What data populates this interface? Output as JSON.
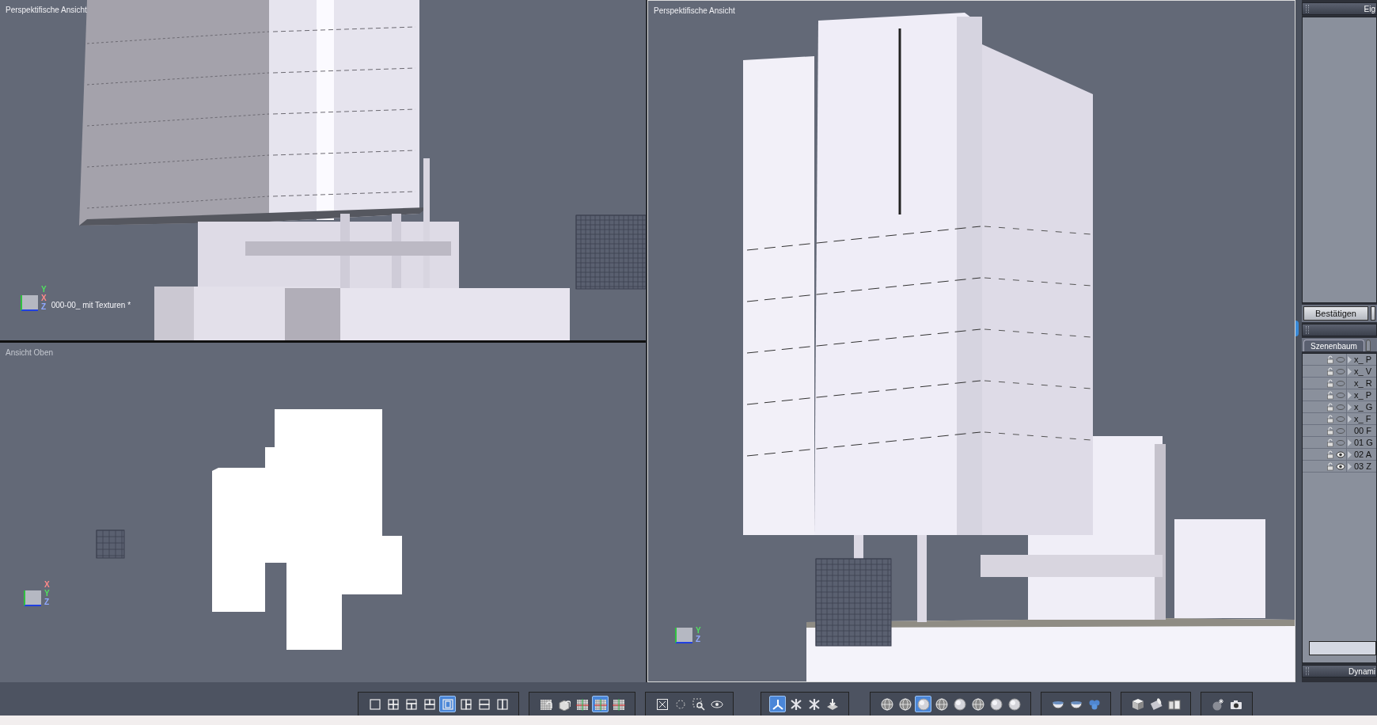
{
  "viewports": [
    {
      "kind": "perspective-left",
      "title": "Perspektifische Ansicht",
      "caption": "000-00_ mit Texturen *",
      "axes": [
        "Y",
        "X",
        "Z"
      ]
    },
    {
      "kind": "top",
      "title": "Ansicht Oben",
      "axes": [
        "X",
        "Y",
        "Z"
      ]
    },
    {
      "kind": "perspective-right",
      "title": "Perspektifische Ansicht",
      "axes": [
        "Y",
        "Z"
      ]
    }
  ],
  "panel": {
    "header": "Eig",
    "confirm_button": "Bestätigen",
    "tabs": [
      {
        "label": "Szenenbaum",
        "selected": true
      }
    ],
    "scene_tree": {
      "items": [
        {
          "label": "x_ P",
          "visible": false,
          "expandable": true
        },
        {
          "label": "x_ V",
          "visible": false,
          "expandable": true
        },
        {
          "label": "x_ R",
          "visible": false,
          "expandable": false
        },
        {
          "label": "x_ P",
          "visible": false,
          "expandable": true
        },
        {
          "label": "x_ G",
          "visible": false,
          "expandable": true
        },
        {
          "label": "x_ F",
          "visible": false,
          "expandable": true
        },
        {
          "label": "00 F",
          "visible": false,
          "expandable": false
        },
        {
          "label": "01 G",
          "visible": false,
          "expandable": true
        },
        {
          "label": "02 A",
          "visible": true,
          "expandable": true
        },
        {
          "label": "03 Z",
          "visible": true,
          "expandable": true
        }
      ]
    },
    "footer_header": "Dynami"
  },
  "toolbar": {
    "groups": [
      {
        "buttons": [
          {
            "kind": "l1",
            "selected": false
          },
          {
            "kind": "l4",
            "selected": false
          },
          {
            "kind": "l3a",
            "selected": false
          },
          {
            "kind": "l3b",
            "selected": false
          },
          {
            "kind": "l2s",
            "selected": true
          },
          {
            "kind": "l3c",
            "selected": false
          },
          {
            "kind": "l2h",
            "selected": false
          },
          {
            "kind": "l2v",
            "selected": false
          }
        ]
      },
      {
        "buttons": [
          {
            "kind": "gridsnap",
            "selected": false
          },
          {
            "kind": "objsnap",
            "selected": false
          },
          {
            "kind": "grid",
            "selected": false
          },
          {
            "kind": "grid",
            "selected": true
          },
          {
            "kind": "grid",
            "selected": false
          }
        ]
      },
      {
        "buttons": [
          {
            "kind": "fit",
            "selected": false
          },
          {
            "kind": "orbit",
            "selected": false
          },
          {
            "kind": "zoom",
            "selected": false
          },
          {
            "kind": "eye",
            "selected": false
          }
        ]
      },
      {
        "buttons": [
          {
            "kind": "axes",
            "selected": true
          },
          {
            "kind": "move",
            "selected": false
          },
          {
            "kind": "move",
            "selected": false
          },
          {
            "kind": "floor",
            "selected": false
          }
        ]
      },
      {
        "buttons": [
          {
            "kind": "wire",
            "selected": false
          },
          {
            "kind": "wire",
            "selected": false
          },
          {
            "kind": "sphere",
            "selected": true
          },
          {
            "kind": "wire",
            "selected": false
          },
          {
            "kind": "sphere",
            "selected": false
          },
          {
            "kind": "wire",
            "selected": false
          },
          {
            "kind": "sphere",
            "selected": false
          },
          {
            "kind": "sphere",
            "selected": false
          }
        ]
      },
      {
        "buttons": [
          {
            "kind": "bowl",
            "selected": false
          },
          {
            "kind": "bowl",
            "selected": false
          },
          {
            "kind": "spheres",
            "selected": false
          }
        ]
      },
      {
        "buttons": [
          {
            "kind": "cube",
            "selected": false
          },
          {
            "kind": "cylinder",
            "selected": false
          },
          {
            "kind": "cups",
            "selected": false
          }
        ]
      },
      {
        "buttons": [
          {
            "kind": "light",
            "selected": false
          },
          {
            "kind": "camera",
            "selected": false
          }
        ]
      }
    ]
  }
}
